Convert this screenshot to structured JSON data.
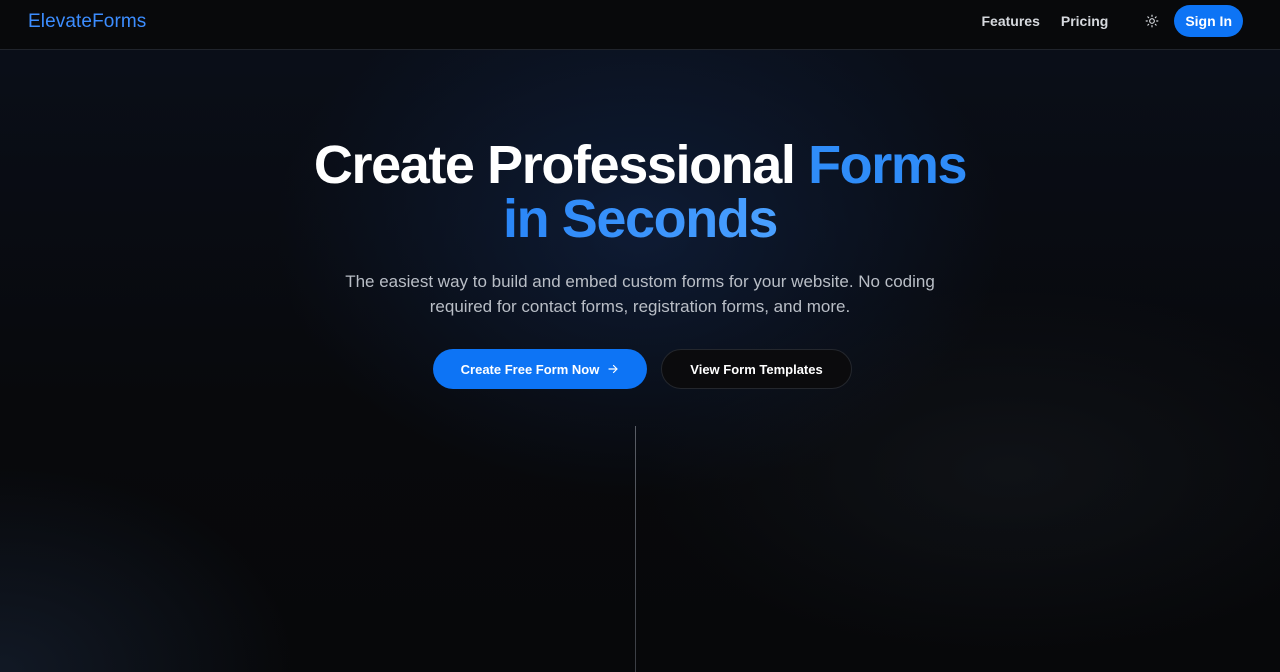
{
  "brand": {
    "name": "ElevateForms",
    "color": "#3c8dff"
  },
  "nav": {
    "features_label": "Features",
    "pricing_label": "Pricing",
    "theme_icon": "sun-icon",
    "signin_label": "Sign In"
  },
  "hero": {
    "title_part1": "Create Professional ",
    "title_part2": "Forms",
    "title_line2": "in Seconds",
    "subtitle_line1": "The easiest way to build and embed custom forms for your website. No coding",
    "subtitle_line2": "required for contact forms, registration forms, and more.",
    "primary_cta": "Create Free Form Now",
    "primary_cta_icon": "arrow-right-icon",
    "secondary_cta": "View Form Templates"
  },
  "colors": {
    "accent": "#0d74f5",
    "background": "#08090c"
  }
}
